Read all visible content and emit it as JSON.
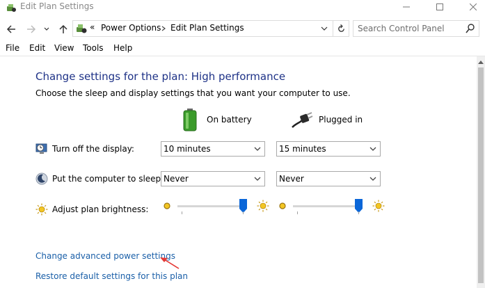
{
  "window": {
    "title": "Edit Plan Settings"
  },
  "address_bar": {
    "overflow_chevron": "«",
    "crumbs": [
      "Power Options",
      "Edit Plan Settings"
    ]
  },
  "search": {
    "placeholder": "Search Control Panel"
  },
  "menu": {
    "items": [
      "File",
      "Edit",
      "View",
      "Tools",
      "Help"
    ]
  },
  "main": {
    "heading": "Change settings for the plan: High performance",
    "subheading": "Choose the sleep and display settings that you want your computer to use.",
    "columns": {
      "on_battery": "On battery",
      "plugged_in": "Plugged in"
    },
    "rows": [
      {
        "label": "Turn off the display:",
        "on_battery": "10 minutes",
        "plugged_in": "15 minutes"
      },
      {
        "label": "Put the computer to sleep:",
        "on_battery": "Never",
        "plugged_in": "Never"
      },
      {
        "label": "Adjust plan brightness:",
        "on_battery_level_percent": 100,
        "plugged_in_level_percent": 100
      }
    ],
    "links": {
      "advanced": "Change advanced power settings",
      "restore": "Restore default settings for this plan"
    }
  },
  "colors": {
    "heading": "#1e3287",
    "link": "#1a5fa8",
    "slider_thumb": "#0a66d8",
    "annotation_arrow": "#e53935"
  },
  "icons": {
    "title": "power-options-icon",
    "back": "back-arrow-icon",
    "forward": "forward-arrow-icon",
    "recent": "chevron-down-icon",
    "up": "up-arrow-icon",
    "address": "power-options-icon",
    "refresh": "refresh-icon",
    "search": "search-icon",
    "battery": "battery-icon",
    "plug": "power-plug-icon",
    "display": "display-timer-icon",
    "sleep": "sleep-moon-icon",
    "brightness": "brightness-sun-icon"
  }
}
